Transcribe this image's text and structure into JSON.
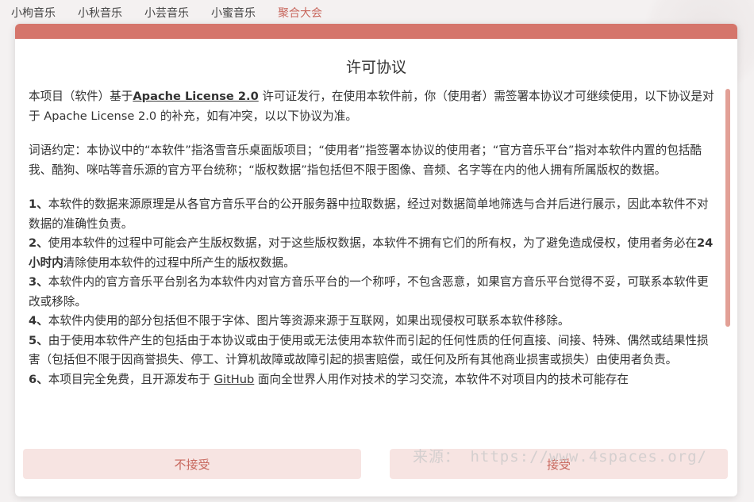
{
  "nav": {
    "tabs": [
      {
        "label": "小枸音乐"
      },
      {
        "label": "小秋音乐"
      },
      {
        "label": "小芸音乐"
      },
      {
        "label": "小蜜音乐"
      },
      {
        "label": "聚合大会"
      }
    ]
  },
  "dialog": {
    "title": "许可协议",
    "intro": {
      "p1_a": "本项目（软件）基于",
      "p1_link": "Apache License 2.0",
      "p1_b": " 许可证发行，在使用本软件前，你（使用者）需签署本协议才可继续使用，以下协议是对于 Apache License 2.0 的补充，如有冲突，以以下协议为准。"
    },
    "terms": "词语约定：本协议中的“本软件”指洛雪音乐桌面版项目；“使用者”指签署本协议的使用者；“官方音乐平台”指对本软件内置的包括酷我、酷狗、咪咕等音乐源的官方平台统称；“版权数据”指包括但不限于图像、音频、名字等在内的他人拥有所属版权的数据。",
    "items": [
      {
        "num": "1、",
        "text": "本软件的数据来源原理是从各官方音乐平台的公开服务器中拉取数据，经过对数据简单地筛选与合并后进行展示，因此本软件不对数据的准确性负责。"
      },
      {
        "num": "2、",
        "text_a": "使用本软件的过程中可能会产生版权数据，对于这些版权数据，本软件不拥有它们的所有权，为了避免造成侵权，使用者务必在",
        "bold": "24小时内",
        "text_b": "清除使用本软件的过程中所产生的版权数据。"
      },
      {
        "num": "3、",
        "text": "本软件内的官方音乐平台别名为本软件内对官方音乐平台的一个称呼，不包含恶意，如果官方音乐平台觉得不妥，可联系本软件更改或移除。"
      },
      {
        "num": "4、",
        "text": "本软件内使用的部分包括但不限于字体、图片等资源来源于互联网，如果出现侵权可联系本软件移除。"
      },
      {
        "num": "5、",
        "text": "由于使用本软件产生的包括由于本协议或由于使用或无法使用本软件而引起的任何性质的任何直接、间接、特殊、偶然或结果性损害（包括但不限于因商誉损失、停工、计算机故障或故障引起的损害赔偿，或任何及所有其他商业损害或损失）由使用者负责。"
      },
      {
        "num": "6、",
        "text_a": "本项目完全免费，且开源发布于 ",
        "link": "GitHub",
        "text_b": " 面向全世界人用作对技术的学习交流，本软件不对项目内的技术可能存在"
      }
    ],
    "decline_label": "不接受",
    "accept_label": "接受"
  },
  "watermark": "来源： https://www.4spaces.org/",
  "colors": {
    "accent": "#d5756b",
    "button_bg": "#f7e4e2",
    "button_text": "#c8685e"
  }
}
